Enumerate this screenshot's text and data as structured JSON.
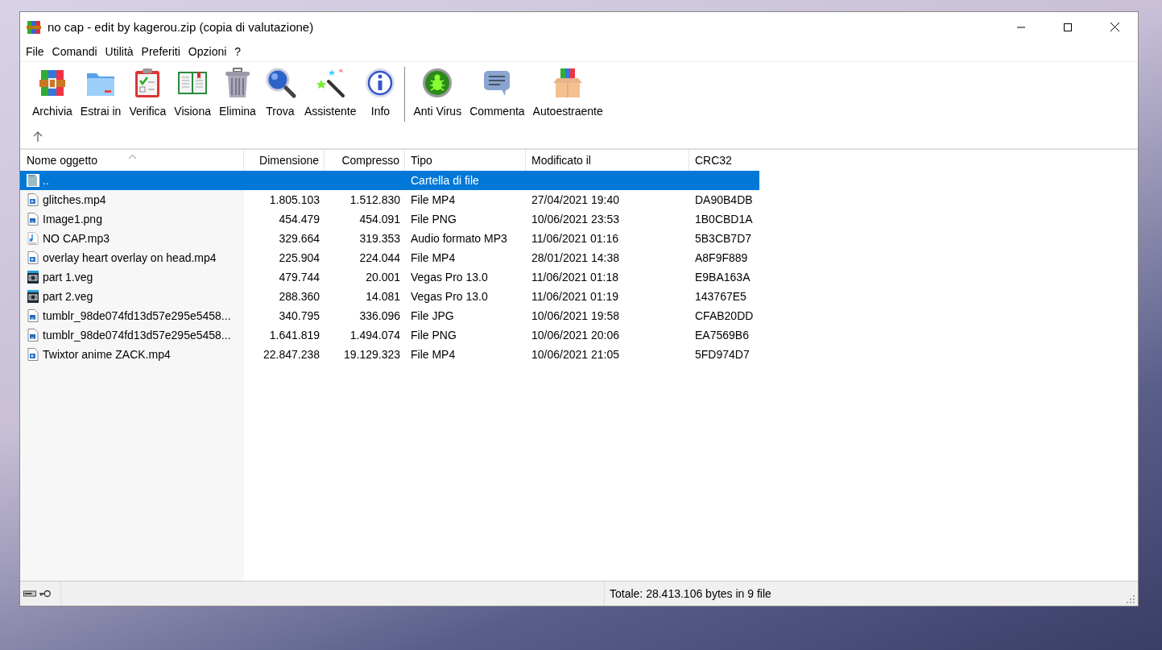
{
  "window": {
    "title": "no cap - edit by kagerou.zip (copia di valutazione)"
  },
  "menu": [
    "File",
    "Comandi",
    "Utilità",
    "Preferiti",
    "Opzioni",
    "?"
  ],
  "toolbar": [
    {
      "label": "Archivia",
      "kind": "archive"
    },
    {
      "label": "Estrai in",
      "kind": "folder"
    },
    {
      "label": "Verifica",
      "kind": "clipboard"
    },
    {
      "label": "Visiona",
      "kind": "book"
    },
    {
      "label": "Elimina",
      "kind": "trash"
    },
    {
      "label": "Trova",
      "kind": "search"
    },
    {
      "label": "Assistente",
      "kind": "wand"
    },
    {
      "label": "Info",
      "kind": "info"
    },
    {
      "label": "Anti Virus",
      "kind": "bug",
      "separator_before": true
    },
    {
      "label": "Commenta",
      "kind": "comment"
    },
    {
      "label": "Autoestraente",
      "kind": "box"
    }
  ],
  "table": {
    "columns": [
      "Nome oggetto",
      "Dimensione",
      "Compresso",
      "Tipo",
      "Modificato il",
      "CRC32"
    ],
    "rows": [
      {
        "kind": "folder",
        "selected": true,
        "cells": [
          "..",
          "",
          "",
          "Cartella di file",
          "",
          ""
        ]
      },
      {
        "kind": "video",
        "selected": false,
        "cells": [
          "glitches.mp4",
          "1.805.103",
          "1.512.830",
          "File MP4",
          "27/04/2021 19:40",
          "DA90B4DB"
        ]
      },
      {
        "kind": "image",
        "selected": false,
        "cells": [
          "Image1.png",
          "454.479",
          "454.091",
          "File PNG",
          "10/06/2021 23:53",
          "1B0CBD1A"
        ]
      },
      {
        "kind": "audio",
        "selected": false,
        "cells": [
          "NO CAP.mp3",
          "329.664",
          "319.353",
          "Audio formato MP3",
          "11/06/2021 01:16",
          "5B3CB7D7"
        ]
      },
      {
        "kind": "video",
        "selected": false,
        "cells": [
          "overlay heart overlay on head.mp4",
          "225.904",
          "224.044",
          "File MP4",
          "28/01/2021 14:38",
          "A8F9F889"
        ]
      },
      {
        "kind": "project",
        "selected": false,
        "cells": [
          "part 1.veg",
          "479.744",
          "20.001",
          "Vegas Pro 13.0",
          "11/06/2021 01:18",
          "E9BA163A"
        ]
      },
      {
        "kind": "project",
        "selected": false,
        "cells": [
          "part 2.veg",
          "288.360",
          "14.081",
          "Vegas Pro 13.0",
          "11/06/2021 01:19",
          "143767E5"
        ]
      },
      {
        "kind": "image",
        "selected": false,
        "cells": [
          "tumblr_98de074fd13d57e295e5458...",
          "340.795",
          "336.096",
          "File JPG",
          "10/06/2021 19:58",
          "CFAB20DD"
        ]
      },
      {
        "kind": "image",
        "selected": false,
        "cells": [
          "tumblr_98de074fd13d57e295e5458...",
          "1.641.819",
          "1.494.074",
          "File PNG",
          "10/06/2021 20:06",
          "EA7569B6"
        ]
      },
      {
        "kind": "video",
        "selected": false,
        "cells": [
          "Twixtor anime ZACK.mp4",
          "22.847.238",
          "19.129.323",
          "File MP4",
          "10/06/2021 21:05",
          "5FD974D7"
        ]
      }
    ]
  },
  "status_bar": {
    "text": "Totale: 28.413.106 bytes in 9 file"
  }
}
